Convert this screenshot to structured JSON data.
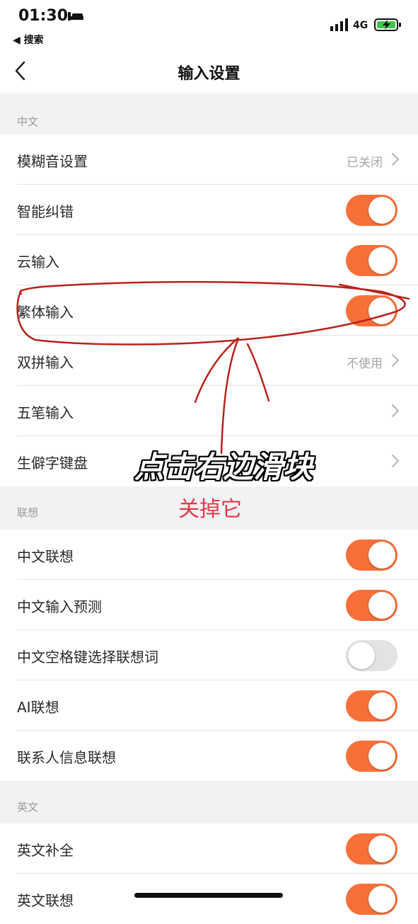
{
  "status_bar": {
    "time": "01:30",
    "back_app": "◀ 搜索",
    "network": "4G",
    "icons": [
      "bed-icon",
      "signal-icon",
      "battery-charging-icon"
    ]
  },
  "nav": {
    "title": "输入设置",
    "back_icon": "chevron-left-icon"
  },
  "sections": [
    {
      "header": "中文",
      "rows": [
        {
          "label": "模糊音设置",
          "type": "link",
          "value": "已关闭"
        },
        {
          "label": "智能纠错",
          "type": "toggle",
          "on": true
        },
        {
          "label": "云输入",
          "type": "toggle",
          "on": true
        },
        {
          "label": "繁体输入",
          "type": "toggle",
          "on": true
        },
        {
          "label": "双拼输入",
          "type": "link",
          "value": "不使用"
        },
        {
          "label": "五笔输入",
          "type": "link",
          "value": ""
        },
        {
          "label": "生僻字键盘",
          "type": "link",
          "value": ""
        }
      ]
    },
    {
      "header": "联想",
      "rows": [
        {
          "label": "中文联想",
          "type": "toggle",
          "on": true
        },
        {
          "label": "中文输入预测",
          "type": "toggle",
          "on": true
        },
        {
          "label": "中文空格键选择联想词",
          "type": "toggle",
          "on": false
        },
        {
          "label": "AI联想",
          "type": "toggle",
          "on": true
        },
        {
          "label": "联系人信息联想",
          "type": "toggle",
          "on": true
        }
      ]
    },
    {
      "header": "英文",
      "rows": [
        {
          "label": "英文补全",
          "type": "toggle",
          "on": true
        },
        {
          "label": "英文联想",
          "type": "toggle",
          "on": true
        }
      ]
    }
  ],
  "annotation": {
    "caption_main": "点击右边滑块",
    "caption_sub": "关掉它",
    "colors": {
      "accent": "#f77039",
      "ink": "#b8231a",
      "caption_sub": "#e23a4a"
    }
  }
}
